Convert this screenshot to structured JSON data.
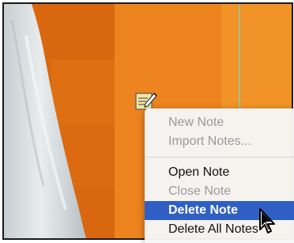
{
  "context_menu": {
    "groups": [
      [
        {
          "label": "New Note",
          "enabled": false
        },
        {
          "label": "Import Notes...",
          "enabled": false
        }
      ],
      [
        {
          "label": "Open Note",
          "enabled": true
        },
        {
          "label": "Close Note",
          "enabled": false
        },
        {
          "label": "Delete Note",
          "enabled": true,
          "selected": true
        },
        {
          "label": "Delete All Notes",
          "enabled": true
        }
      ]
    ]
  },
  "icons": {
    "note": "note-pencil-icon",
    "cursor": "arrow-cursor-icon"
  },
  "colors": {
    "selection": "#2f5fc4",
    "background_orange": "#ec7c1e",
    "menu_bg": "#f6f6f6"
  }
}
